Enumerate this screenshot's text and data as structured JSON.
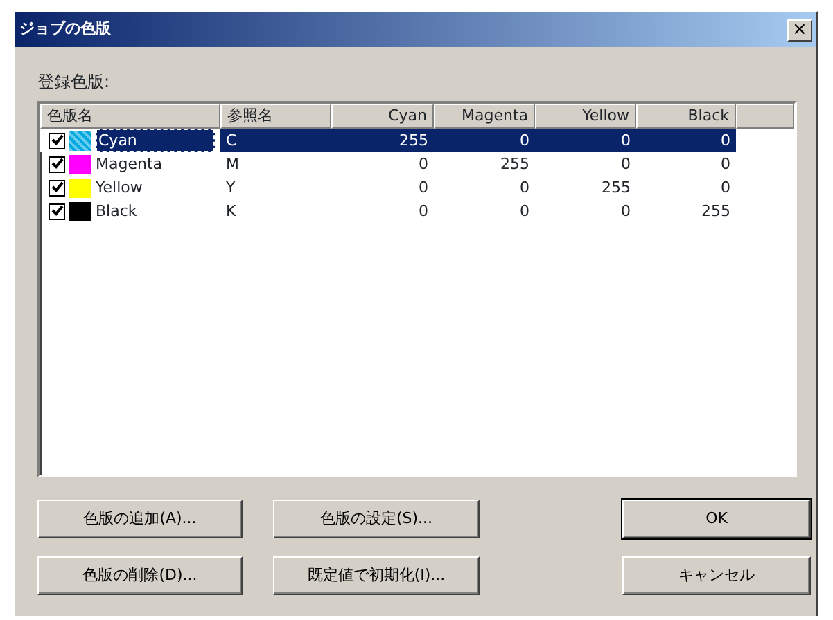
{
  "window": {
    "title": "ジョブの色版",
    "close": "×"
  },
  "list_label": "登録色版:",
  "table": {
    "columns": [
      "色版名",
      "参照名",
      "Cyan",
      "Magenta",
      "Yellow",
      "Black"
    ],
    "rows": [
      {
        "checked": true,
        "color": "#00a8e0",
        "selected": true,
        "cells": [
          "Cyan",
          "C",
          "255",
          "0",
          "0",
          "0"
        ]
      },
      {
        "checked": true,
        "color": "#ff00ff",
        "selected": false,
        "cells": [
          "Magenta",
          "M",
          "0",
          "255",
          "0",
          "0"
        ]
      },
      {
        "checked": true,
        "color": "#ffff00",
        "selected": false,
        "cells": [
          "Yellow",
          "Y",
          "0",
          "0",
          "255",
          "0"
        ]
      },
      {
        "checked": true,
        "color": "#000000",
        "selected": false,
        "cells": [
          "Black",
          "K",
          "0",
          "0",
          "0",
          "255"
        ]
      }
    ]
  },
  "buttons": [
    {
      "label": "色版の追加(A)...",
      "default": false
    },
    {
      "label": "色版の設定(S)...",
      "default": false
    },
    {
      "label": "OK",
      "default": true
    },
    {
      "label": "色版の削除(D)...",
      "default": false
    },
    {
      "label": "既定値で初期化(I)...",
      "default": false
    },
    {
      "label": "キャンセル",
      "default": false
    }
  ]
}
